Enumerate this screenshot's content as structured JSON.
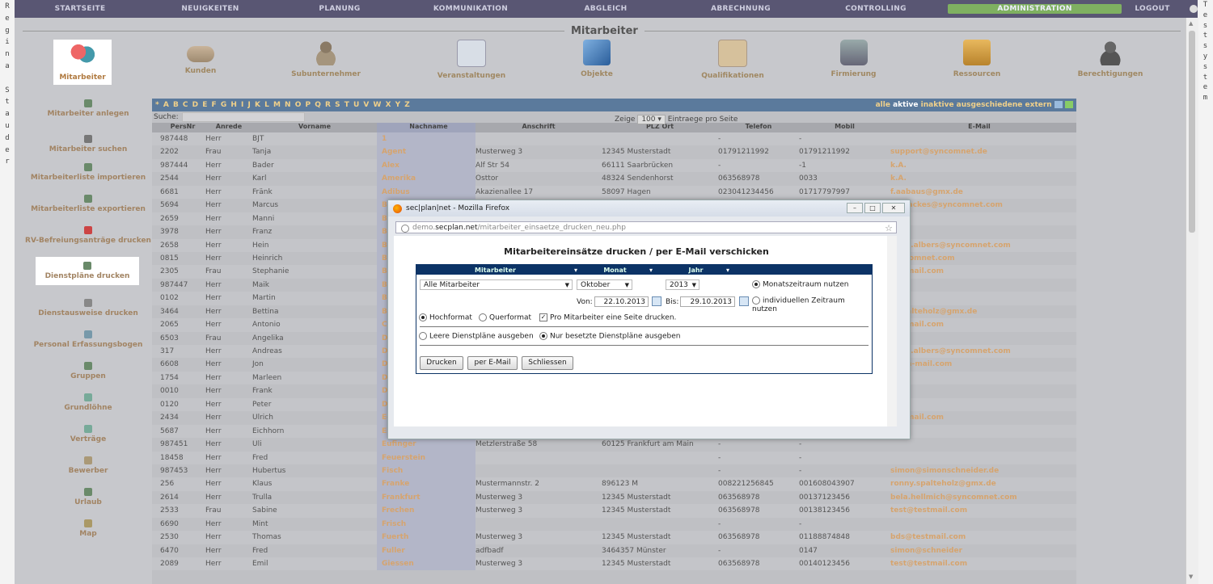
{
  "left_vertical": [
    "R",
    "e",
    "g",
    "i",
    "n",
    "a",
    "",
    "S",
    "t",
    "a",
    "u",
    "d",
    "e",
    "r"
  ],
  "right_vertical": [
    "T",
    "e",
    "s",
    "t",
    "s",
    "y",
    "s",
    "t",
    "e",
    "m"
  ],
  "topnav": [
    "STARTSEITE",
    "NEUIGKEITEN",
    "PLANUNG",
    "KOMMUNIKATION",
    "ABGLEICH",
    "ABRECHNUNG",
    "CONTROLLING",
    "ADMINISTRATION",
    "LOGOUT"
  ],
  "page_title": "Mitarbeiter",
  "modules": [
    "Mitarbeiter",
    "Kunden",
    "Subunternehmer",
    "Veranstaltungen",
    "Objekte",
    "Qualifikationen",
    "Firmierung",
    "Ressourcen",
    "Berechtigungen"
  ],
  "sidebar": [
    "Mitarbeiter anlegen",
    "Mitarbeiter suchen",
    "Mitarbeiterliste importieren",
    "Mitarbeiterliste exportieren",
    "RV-Befreiungsanträge drucken",
    "Dienstpläne drucken",
    "Dienstausweise drucken",
    "Personal Erfassungsbogen",
    "Gruppen",
    "Grundlöhne",
    "Verträge",
    "Bewerber",
    "Urlaub",
    "Map"
  ],
  "grid": {
    "alphabet": "* A B C D E F G H I J K L M N O P Q R S T U V W X Y Z",
    "filter_alle": "alle",
    "filter_aktive": "aktive",
    "filter_rest": "inaktive ausgeschiedene extern",
    "search_label": "Suche:",
    "zeige_label": "Zeige",
    "page_size": "100",
    "entries_label": "Eintraege pro Seite",
    "columns": [
      "PersNr",
      "Anrede",
      "Vorname",
      "Nachname",
      "Anschrift",
      "PLZ Ort",
      "Telefon",
      "Mobil",
      "E-Mail"
    ],
    "rows": [
      [
        "987448",
        "Herr",
        "BJT",
        "1",
        "",
        "",
        "-",
        "-",
        ""
      ],
      [
        "2202",
        "Frau",
        "Tanja",
        "Agent",
        "Musterweg 3",
        "12345 Musterstadt",
        "01791211992",
        "01791211992",
        "support@syncomnet.de"
      ],
      [
        "987444",
        "Herr",
        "Bader",
        "Alex",
        "Alf Str 54",
        "66111 Saarbrücken",
        "-",
        "-1",
        "k.A."
      ],
      [
        "2544",
        "Herr",
        "Karl",
        "Amerika",
        "Osttor",
        "48324 Sendenhorst",
        "063568978",
        "0033",
        "k.A."
      ],
      [
        "6681",
        "Herr",
        "Fränk",
        "Adibus",
        "Akazienallee 17",
        "58097 Hagen",
        "023041234456",
        "01717797997",
        "f.aabaus@gmx.de"
      ],
      [
        "5694",
        "Herr",
        "Marcus",
        "Backes",
        "",
        "",
        "",
        "",
        "us.backes@syncomnet.com"
      ],
      [
        "2659",
        "Herr",
        "Manni",
        "Ba",
        "",
        "",
        "",
        "",
        ""
      ],
      [
        "3978",
        "Herr",
        "Franz",
        "Ba",
        "",
        "",
        "",
        "",
        ""
      ],
      [
        "2658",
        "Herr",
        "Hein",
        "Bl",
        "",
        "",
        "",
        "",
        "stian.albers@syncomnet.com"
      ],
      [
        "0815",
        "Herr",
        "Heinrich",
        "Bl",
        "",
        "",
        "",
        "",
        "syncomnet.com"
      ],
      [
        "2305",
        "Frau",
        "Stephanie",
        "Bo",
        "",
        "",
        "",
        "",
        "testmail.com"
      ],
      [
        "987447",
        "Herr",
        "Maik",
        "Bo",
        "",
        "",
        "",
        "",
        ""
      ],
      [
        "0102",
        "Herr",
        "Martin",
        "Br",
        "",
        "",
        "",
        "",
        ""
      ],
      [
        "3464",
        "Herr",
        "Bettina",
        "Bö",
        "",
        "",
        "",
        "",
        "y.spalteholz@gmx.de"
      ],
      [
        "2065",
        "Herr",
        "Antonio",
        "Ca",
        "",
        "",
        "",
        "",
        "testmail.com"
      ],
      [
        "6503",
        "Frau",
        "Angelika",
        "De",
        "",
        "",
        "",
        "",
        ""
      ],
      [
        "317",
        "Herr",
        "Andreas",
        "De",
        "",
        "",
        "",
        "",
        "stian.albers@syncomnet.com"
      ],
      [
        "6608",
        "Herr",
        "Jon",
        "Do",
        "",
        "",
        "",
        "",
        "trash-mail.com"
      ],
      [
        "1754",
        "Herr",
        "Marleen",
        "Dr",
        "",
        "",
        "",
        "",
        ""
      ],
      [
        "0010",
        "Herr",
        "Frank",
        "Du",
        "",
        "",
        "",
        "",
        ""
      ],
      [
        "0120",
        "Herr",
        "Peter",
        "Dü",
        "",
        "",
        "",
        "",
        ""
      ],
      [
        "2434",
        "Herr",
        "Ulrich",
        "Eg",
        "",
        "",
        "",
        "",
        "testmail.com"
      ],
      [
        "5687",
        "Herr",
        "Eichhorn",
        "Eichel",
        "",
        "",
        "-",
        "-",
        ""
      ],
      [
        "987451",
        "Herr",
        "Uli",
        "Eufinger",
        "Metzlerstraße 58",
        "60125 Frankfurt am Main",
        "-",
        "-",
        ""
      ],
      [
        "18458",
        "Herr",
        "Fred",
        "Feuerstein",
        "",
        "",
        "-",
        "-",
        ""
      ],
      [
        "987453",
        "Herr",
        "Hubertus",
        "Fisch",
        "",
        "",
        "-",
        "-",
        "simon@simonschneider.de"
      ],
      [
        "256",
        "Herr",
        "Klaus",
        "Franke",
        "Mustermannstr. 2",
        "896123 M",
        "008221256845",
        "001608043907",
        "ronny.spalteholz@gmx.de"
      ],
      [
        "2614",
        "Herr",
        "Trulla",
        "Frankfurt",
        "Musterweg 3",
        "12345 Musterstadt",
        "063568978",
        "00137123456",
        "bela.hellmich@syncomnet.com"
      ],
      [
        "2533",
        "Frau",
        "Sabine",
        "Frechen",
        "Musterweg 3",
        "12345 Musterstadt",
        "063568978",
        "00138123456",
        "test@testmail.com"
      ],
      [
        "6690",
        "Herr",
        "Mint",
        "Frisch",
        "",
        "",
        "-",
        "-",
        ""
      ],
      [
        "2530",
        "Herr",
        "Thomas",
        "Fuerth",
        "Musterweg 3",
        "12345 Musterstadt",
        "063568978",
        "01188874848",
        "bds@testmail.com"
      ],
      [
        "6470",
        "Herr",
        "Fred",
        "Fuller",
        "adfbadf",
        "3464357 Münster",
        "-",
        "0147",
        "simon@schneider"
      ],
      [
        "2089",
        "Herr",
        "Emil",
        "Giessen",
        "Musterweg 3",
        "12345 Musterstadt",
        "063568978",
        "00140123456",
        "test@testmail.com"
      ]
    ]
  },
  "popup": {
    "window_title": "sec|plan|net - Mozilla Firefox",
    "url_prefix": "demo.",
    "url_domain": "secplan.net",
    "url_path": "/mitarbeiter_einsaetze_drucken_neu.php",
    "dialog_title": "Mitarbeitereinsätze drucken / per E-Mail verschicken",
    "head_mitarbeiter": "Mitarbeiter",
    "head_monat": "Monat",
    "head_jahr": "Jahr",
    "mitarbeiter_value": "Alle Mitarbeiter",
    "monat_value": "Oktober",
    "jahr_value": "2013",
    "opt_monatszeitraum": "Monatszeitraum nutzen",
    "opt_individuell": "individuellen Zeitraum nutzen",
    "von_label": "Von:",
    "von_value": "22.10.2013",
    "bis_label": "Bis:",
    "bis_value": "29.10.2013",
    "opt_hochformat": "Hochformat",
    "opt_querformat": "Querformat",
    "chk_pro_seite": "Pro Mitarbeiter eine Seite drucken.",
    "opt_leere": "Leere Dienstpläne ausgeben",
    "opt_besetzte": "Nur besetzte Dienstpläne ausgeben",
    "btn_drucken": "Drucken",
    "btn_email": "per E-Mail",
    "btn_schliessen": "Schliessen"
  },
  "colors": {
    "nav_bg": "#595673",
    "active_nav": "#7fb061",
    "grid_header": "#5b7a9c",
    "form_header": "#0c3366",
    "accent": "#d6a46e"
  }
}
